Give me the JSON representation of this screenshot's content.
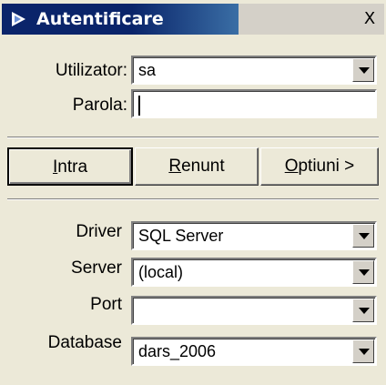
{
  "window": {
    "title": "Autentificare",
    "close_glyph": "X"
  },
  "login": {
    "user_label": "Utilizator:",
    "user_value": "sa",
    "password_label": "Parola:",
    "password_value": ""
  },
  "buttons": {
    "enter_mnemonic": "I",
    "enter_rest": "ntra",
    "cancel_mnemonic": "R",
    "cancel_rest": "enunt",
    "options_mnemonic": "O",
    "options_rest": "ptiuni >"
  },
  "connection": {
    "driver_label": "Driver",
    "driver_value": "SQL Server",
    "server_label": "Server",
    "server_value": "(local)",
    "port_label": "Port",
    "port_value": "",
    "database_label": "Database",
    "database_value": "dars_2006"
  },
  "icons": {
    "title": "play-arrow-icon",
    "dropdown": "chevron-down-icon"
  },
  "colors": {
    "titlebar": "#0a246a",
    "dialog_bg": "#ece9d8"
  }
}
